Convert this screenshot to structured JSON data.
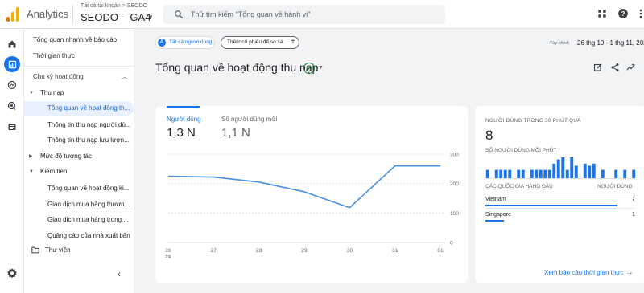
{
  "header": {
    "app_name": "Analytics",
    "account_crumb": "Tất cả tài khoản > SEODO",
    "property_name": "SEODO – GA4",
    "search_placeholder": "Thử tìm kiếm \"Tổng quan về hành vi\"",
    "icons": [
      "apps-grid-icon",
      "help-icon",
      "more-vert-icon"
    ],
    "brand_colors": [
      "#f9ab00",
      "#e37400"
    ]
  },
  "rail": {
    "icons": [
      "home-icon",
      "reports-icon",
      "explore-icon",
      "advertising-icon",
      "configure-icon",
      "settings-gear-icon"
    ],
    "active": "reports-icon",
    "accent": "#1a73e8"
  },
  "nav": {
    "items": [
      {
        "label": "Tổng quan nhanh về báo cáo"
      },
      {
        "label": "Thời gian thực"
      },
      {
        "label": "Chu kỳ hoạt động"
      },
      {
        "label": "Thu nạp"
      },
      {
        "label": "Tổng quan về hoạt động th..."
      },
      {
        "label": "Thông tin thu nạp người dù..."
      },
      {
        "label": "Thông tin thu nạp lưu lượn..."
      },
      {
        "label": "Mức độ tương tác"
      },
      {
        "label": "Kiếm tiền"
      },
      {
        "label": "Tổng quan về hoạt động ki..."
      },
      {
        "label": "Giao dịch mua hàng thươn..."
      },
      {
        "label": "Giao dịch mua hàng trong ..."
      },
      {
        "label": "Quảng cáo của nhà xuất bản"
      },
      {
        "label": "Thư viện"
      }
    ],
    "active_index": 4
  },
  "main": {
    "filter_chip": "Tất cả người dùng",
    "compare_chip": "Thêm cổ phiếu để so sá...",
    "date_label": "Tùy chỉnh",
    "date_range": "26 thg 10 - 1 thg 11, 202",
    "page_title": "Tổng quan về hoạt động thu nạp",
    "action_icons": [
      "customize-report-icon",
      "share-icon",
      "insights-icon"
    ]
  },
  "metrics": [
    {
      "label": "Người dùng",
      "value": "1,3 N"
    },
    {
      "label": "Số người dùng mới",
      "value": "1,1 N"
    }
  ],
  "chart_data": {
    "type": "line",
    "x": [
      "26",
      "27",
      "28",
      "29",
      "30",
      "31",
      "01"
    ],
    "x_sub": "thg",
    "series": [
      {
        "values": [
          225,
          222,
          205,
          172,
          118,
          260,
          260
        ],
        "color": "#4a90e2"
      }
    ],
    "yticks": [
      "300",
      "200",
      "100",
      "0"
    ],
    "ylim": [
      0,
      300
    ],
    "grid": true
  },
  "realtime": {
    "title": "NGƯỜI DÙNG TRONG 30 PHÚT QUA",
    "value": "8",
    "per_minute_label": "SỐ NGƯỜI DÙNG MỖI PHÚT",
    "bars": [
      0.4,
      0,
      0.4,
      0.4,
      0.4,
      0.4,
      0,
      0.4,
      0.4,
      0,
      0.4,
      0.4,
      0.4,
      0.4,
      0.4,
      0.7,
      0.9,
      1.0,
      0.4,
      1.0,
      0.6,
      0,
      0.7,
      0.6,
      0.7,
      0,
      0.4,
      0,
      0,
      0.4,
      0,
      0.4,
      0,
      0.4
    ],
    "col_country": "CÁC QUỐC GIA HÀNG ĐẦU",
    "col_users": "NGƯỜI DÙNG",
    "rows": [
      {
        "name": "Vietnam",
        "value": "7",
        "share": 0.875
      },
      {
        "name": "Singapore",
        "value": "1",
        "share": 0.125
      }
    ],
    "link": "Xem báo cáo thời gian thực"
  }
}
